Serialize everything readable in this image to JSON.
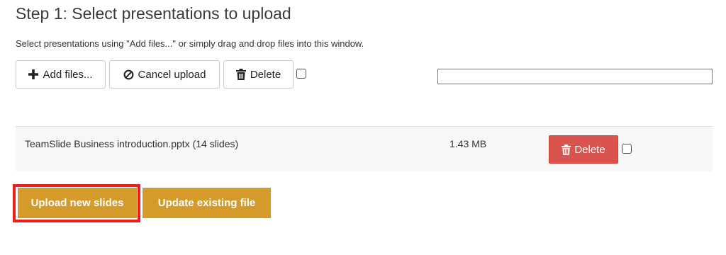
{
  "page": {
    "title": "Step 1: Select presentations to upload",
    "instructions": "Select presentations using \"Add files...\" or simply drag and drop files into this window."
  },
  "toolbar": {
    "add_label": "Add files...",
    "add_icon": "plus-icon",
    "cancel_label": "Cancel upload",
    "cancel_icon": "ban-icon",
    "delete_label": "Delete",
    "delete_icon": "trash-icon",
    "select_all_checked": false
  },
  "progress": {
    "fraction": 0
  },
  "files": [
    {
      "name": "TeamSlide Business introduction.pptx (14 slides)",
      "size": "1.43 MB",
      "delete_label": "Delete",
      "delete_icon": "trash-icon",
      "checked": false
    }
  ],
  "actions": {
    "upload_new_label": "Upload new slides",
    "update_existing_label": "Update existing file"
  },
  "colors": {
    "action_button": "#d49a2a",
    "delete_button": "#d9534f",
    "highlight": "#ee1c1c"
  }
}
